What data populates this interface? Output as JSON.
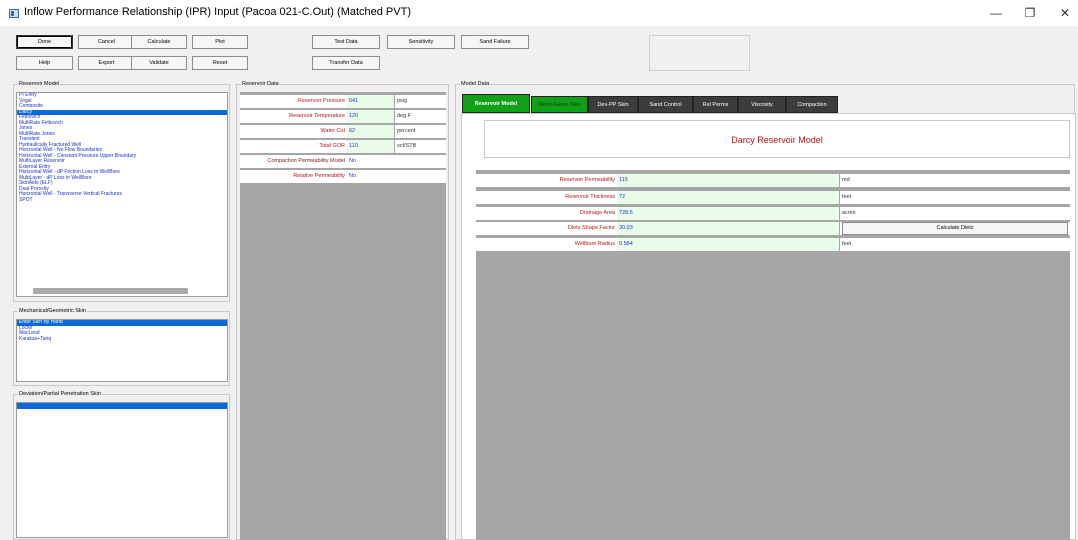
{
  "window": {
    "title": "Inflow Performance Relationship (IPR) Input (Pacoa 021-C.Out) (Matched PVT)",
    "minimize_glyph": "—",
    "maximize_glyph": "❐",
    "close_glyph": "✕"
  },
  "toolbar": {
    "done": "Done",
    "cancel": "Cancel",
    "calculate": "Calculate",
    "plot": "Plot",
    "help": "Help",
    "export": "Export",
    "validate": "Validate",
    "reset": "Reset",
    "test_data": "Test Data",
    "sensitivity": "Sensitivity",
    "sand_failure": "Sand Failure",
    "transfer_data": "Transfer Data"
  },
  "reservoir_model": {
    "label": "Reservoir Model",
    "items": [
      "PI Entry",
      "Vogel",
      "Composite",
      "Darcy",
      "Fetkovich",
      "MultiRate Fetkovich",
      "Jones",
      "MultiRate Jones",
      "Transient",
      "Hydraulically Fractured Well",
      "Horizontal Well - No Flow Boundaries",
      "Horizontal Well - Constant Pressure Upper Boundary",
      "MultiLayer Reservoir",
      "External Entry",
      "Horizontal Well - dP Friction Loss In WellBore",
      "MultiLayer - dP Loss In WellBore",
      "SkinAide (ELF)",
      "Dual Porosity",
      "Horizontal Well - Transverse Vertical Fractures",
      "SPOT"
    ],
    "selected": "Darcy"
  },
  "mech_skin": {
    "label": "Mechanical/Geometric Skin",
    "items": [
      "Enter Skin By Hand",
      "Locke",
      "MacLeod",
      "Karakas+Tariq"
    ],
    "selected": "Enter Skin By Hand"
  },
  "dev_skin": {
    "label": "Deviation/Partial Penetration Skin",
    "items": [
      ""
    ]
  },
  "reservoir_data": {
    "label": "Reservoir Data",
    "rows": [
      {
        "label": "Reservoir Pressure",
        "value": "641",
        "unit": "psig"
      },
      {
        "label": "Reservoir Temperature",
        "value": "120",
        "unit": "deg F"
      },
      {
        "label": "Water Cut",
        "value": "62",
        "unit": "percent"
      },
      {
        "label": "Total GOR",
        "value": "110",
        "unit": "scf/STB"
      },
      {
        "label": "Compaction Permeability Model",
        "value": "No",
        "unit": ""
      },
      {
        "label": "Relative Permeability",
        "value": "No",
        "unit": ""
      }
    ]
  },
  "model_data": {
    "label": "Model Data",
    "tabs": [
      "Reservoir Model",
      "Mech-Geom Skin",
      "Dev-PP Skin",
      "Sand Control",
      "Rel Perms",
      "Viscosity",
      "Compaction"
    ],
    "title": "Darcy Reservoir Model",
    "rows": [
      {
        "label": "Reservoir Permeability",
        "value": "115",
        "unit": "md"
      },
      {
        "label": "Reservoir Thickness",
        "value": "72",
        "unit": "feet"
      },
      {
        "label": "Drainage Area",
        "value": "728.5",
        "unit": "acres"
      },
      {
        "label": "Dietz Shape Factor",
        "value": "30.03",
        "unit": ""
      },
      {
        "label": "Wellbore Radius",
        "value": "0.584",
        "unit": "feet"
      }
    ],
    "calc_dietz": "Calculate Dietz"
  },
  "colors": {
    "active_tab": "#12a018",
    "dark_tab": "#3c3c3c",
    "selection": "#0a6ad8",
    "link_text": "#1c35c8",
    "label_red": "#b01818",
    "value_bg": "#e9fbe9"
  }
}
